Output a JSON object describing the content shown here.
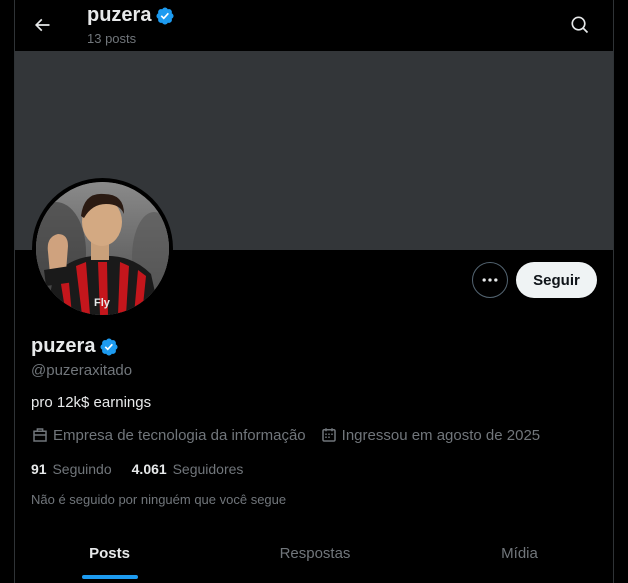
{
  "header": {
    "title": "puzera",
    "subtitle": "13 posts"
  },
  "profile": {
    "name": "puzera",
    "handle": "@puzeraxitado",
    "bio": "pro 12k$ earnings",
    "category": "Empresa de tecnologia da informação",
    "joined": "Ingressou em agosto de 2025",
    "following_count": "91",
    "following_label": "Seguindo",
    "followers_count": "4.061",
    "followers_label": "Seguidores",
    "followed_by_note": "Não é seguido por ninguém que você segue"
  },
  "actions": {
    "follow_label": "Seguir"
  },
  "tabs": [
    {
      "label": "Posts",
      "active": true
    },
    {
      "label": "Respostas",
      "active": false
    },
    {
      "label": "Mídia",
      "active": false
    }
  ],
  "colors": {
    "background": "#000000",
    "banner": "#333639",
    "verified": "#1d9bf0",
    "accent": "#1d9bf0",
    "muted_text": "#71767b",
    "primary_text": "#e7e9ea"
  },
  "icons": {
    "back": "arrow-left-icon",
    "search": "search-icon",
    "verified": "verified-badge-icon",
    "more": "more-horizontal-icon",
    "category": "briefcase-icon",
    "joined": "calendar-icon"
  }
}
